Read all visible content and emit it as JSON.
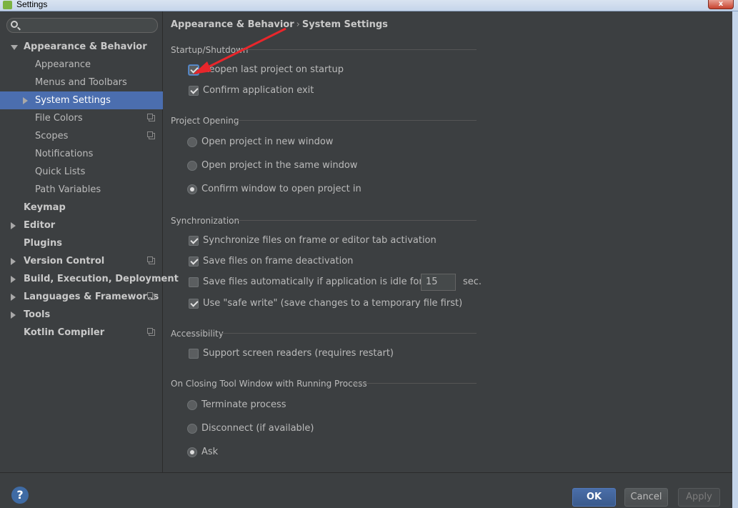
{
  "window": {
    "title": "Settings",
    "close_symbol": "x"
  },
  "search": {
    "placeholder": ""
  },
  "sidebar": {
    "items": [
      {
        "label": "Appearance & Behavior",
        "bold": true,
        "arrow": "down"
      },
      {
        "label": "Appearance"
      },
      {
        "label": "Menus and Toolbars"
      },
      {
        "label": "System Settings",
        "arrow": "right",
        "selected": true
      },
      {
        "label": "File Colors",
        "project_icon": true
      },
      {
        "label": "Scopes",
        "project_icon": true
      },
      {
        "label": "Notifications"
      },
      {
        "label": "Quick Lists"
      },
      {
        "label": "Path Variables"
      },
      {
        "label": "Keymap",
        "bold": true
      },
      {
        "label": "Editor",
        "bold": true,
        "arrow": "right"
      },
      {
        "label": "Plugins",
        "bold": true
      },
      {
        "label": "Version Control",
        "bold": true,
        "arrow": "right",
        "project_icon": true
      },
      {
        "label": "Build, Execution, Deployment",
        "bold": true,
        "arrow": "right"
      },
      {
        "label": "Languages & Frameworks",
        "bold": true,
        "arrow": "right",
        "project_icon": true
      },
      {
        "label": "Tools",
        "bold": true,
        "arrow": "right"
      },
      {
        "label": "Kotlin Compiler",
        "bold": true,
        "project_icon": true
      }
    ],
    "help": "?"
  },
  "breadcrumb": {
    "parent": "Appearance & Behavior",
    "separator": "›",
    "current": "System Settings"
  },
  "sections": {
    "startup": {
      "title": "Startup/Shutdown",
      "reopen": {
        "label": "Reopen last project on startup",
        "checked": true
      },
      "confirm_exit": {
        "label": "Confirm application exit",
        "checked": true
      }
    },
    "project_opening": {
      "title": "Project Opening",
      "new_window": {
        "label": "Open project in new window",
        "selected": false
      },
      "same_window": {
        "label": "Open project in the same window",
        "selected": false
      },
      "confirm_window": {
        "label": "Confirm window to open project in",
        "selected": true
      }
    },
    "sync": {
      "title": "Synchronization",
      "sync_files": {
        "label": "Synchronize files on frame or editor tab activation",
        "checked": true
      },
      "save_deactivation": {
        "label": "Save files on frame deactivation",
        "checked": true
      },
      "save_idle": {
        "label": "Save files automatically if application is idle for",
        "checked": false,
        "value": "15",
        "unit": "sec."
      },
      "safe_write": {
        "label": "Use \"safe write\" (save changes to a temporary file first)",
        "checked": true
      }
    },
    "accessibility": {
      "title": "Accessibility",
      "screen_readers": {
        "label": "Support screen readers (requires restart)",
        "checked": false
      }
    },
    "closing": {
      "title": "On Closing Tool Window with Running Process",
      "terminate": {
        "label": "Terminate process",
        "selected": false
      },
      "disconnect": {
        "label": "Disconnect (if available)",
        "selected": false
      },
      "ask": {
        "label": "Ask",
        "selected": true
      }
    }
  },
  "buttons": {
    "ok": "OK",
    "cancel": "Cancel",
    "apply": "Apply"
  },
  "colors": {
    "annotation_arrow": "#e8262b",
    "selected_row": "#4b6eaf",
    "background": "#3c3f41"
  }
}
